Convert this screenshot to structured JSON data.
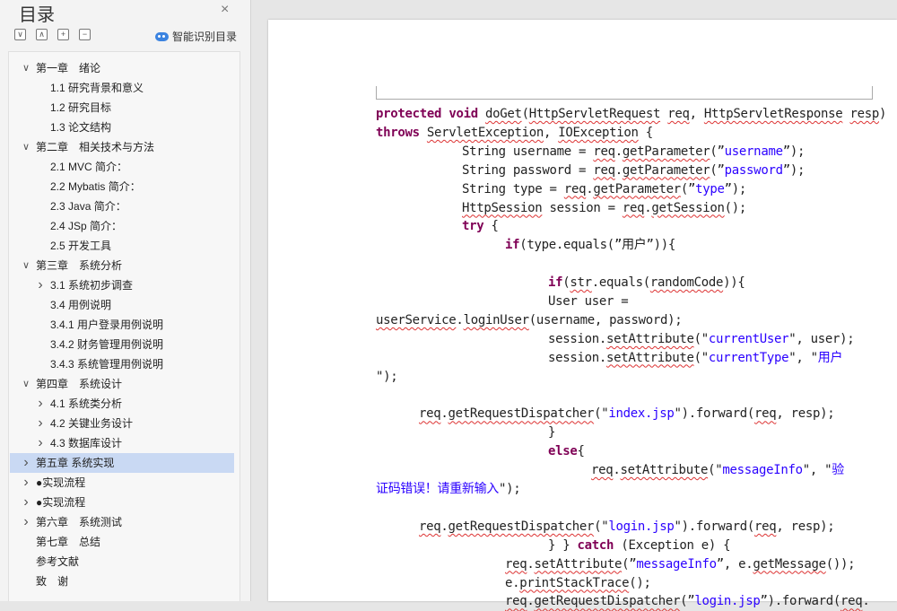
{
  "nav": {
    "title": "目录",
    "close_symbol": "×",
    "toolbar": {
      "collapse_all": "∨",
      "expand_all": "∧",
      "add": "+",
      "remove": "−"
    },
    "smart_label": "智能识别目录",
    "items": [
      {
        "label": "第一章　绪论",
        "level": 1,
        "arrow": "down"
      },
      {
        "label": "1.1 研究背景和意义",
        "level": 2
      },
      {
        "label": "1.2 研究目标",
        "level": 2
      },
      {
        "label": "1.3 论文结构",
        "level": 2
      },
      {
        "label": "第二章　相关技术与方法",
        "level": 1,
        "arrow": "down"
      },
      {
        "label": "2.1 MVC 简介：",
        "level": 2
      },
      {
        "label": "2.2 Mybatis 简介：",
        "level": 2
      },
      {
        "label": "2.3 Java 简介：",
        "level": 2
      },
      {
        "label": "2.4 JSp 简介：",
        "level": 2
      },
      {
        "label": "2.5 开发工具",
        "level": 2
      },
      {
        "label": "第三章　系统分析",
        "level": 1,
        "arrow": "down"
      },
      {
        "label": "3.1 系统初步调查",
        "level": 2,
        "arrow": "right"
      },
      {
        "label": "3.4 用例说明",
        "level": 2
      },
      {
        "label": "3.4.1 用户登录用例说明",
        "level": 2
      },
      {
        "label": "3.4.2 财务管理用例说明",
        "level": 2
      },
      {
        "label": "3.4.3 系统管理用例说明",
        "level": 2
      },
      {
        "label": "第四章　系统设计",
        "level": 1,
        "arrow": "down"
      },
      {
        "label": "4.1 系统类分析",
        "level": 2,
        "arrow": "right"
      },
      {
        "label": "4.2 关键业务设计",
        "level": 2,
        "arrow": "right"
      },
      {
        "label": "4.3 数据库设计",
        "level": 2,
        "arrow": "right"
      },
      {
        "label": "第五章  系统实现",
        "level": 1,
        "arrow": "right",
        "selected": true
      },
      {
        "label": "●实现流程",
        "level": 1,
        "arrow": "right"
      },
      {
        "label": "●实现流程",
        "level": 1,
        "arrow": "right"
      },
      {
        "label": "第六章　系统测试",
        "level": 1,
        "arrow": "right"
      },
      {
        "label": "第七章　总结",
        "level": 1
      },
      {
        "label": "参考文献",
        "level": 1
      },
      {
        "label": "致　谢",
        "level": 1
      }
    ]
  },
  "code_lines": [
    {
      "indent": 0,
      "tokens": [
        {
          "t": "protected",
          "c": "k"
        },
        {
          "t": " "
        },
        {
          "t": "void",
          "c": "k"
        },
        {
          "t": " "
        },
        {
          "t": "doGet",
          "c": "w"
        },
        {
          "t": "("
        },
        {
          "t": "HttpServletRequest",
          "c": "w"
        },
        {
          "t": " "
        },
        {
          "t": "req",
          "c": "w"
        },
        {
          "t": ", "
        },
        {
          "t": "HttpServletResponse",
          "c": "w"
        },
        {
          "t": " "
        },
        {
          "t": "resp",
          "c": "w"
        },
        {
          "t": ")"
        }
      ]
    },
    {
      "indent": 0,
      "tokens": [
        {
          "t": "throws",
          "c": "k"
        },
        {
          "t": " "
        },
        {
          "t": "ServletException",
          "c": "w"
        },
        {
          "t": ", "
        },
        {
          "t": "IOException",
          "c": "w"
        },
        {
          "t": " {"
        }
      ]
    },
    {
      "indent": 96,
      "tokens": [
        {
          "t": "String username = "
        },
        {
          "t": "req",
          "c": "w"
        },
        {
          "t": "."
        },
        {
          "t": "getParameter",
          "c": "w"
        },
        {
          "t": "(”"
        },
        {
          "t": "username",
          "c": "s"
        },
        {
          "t": "”);"
        }
      ]
    },
    {
      "indent": 96,
      "tokens": [
        {
          "t": "String password = "
        },
        {
          "t": "req",
          "c": "w"
        },
        {
          "t": "."
        },
        {
          "t": "getParameter",
          "c": "w"
        },
        {
          "t": "(”"
        },
        {
          "t": "password",
          "c": "s"
        },
        {
          "t": "”);"
        }
      ]
    },
    {
      "indent": 96,
      "tokens": [
        {
          "t": "String type = "
        },
        {
          "t": "req",
          "c": "w"
        },
        {
          "t": "."
        },
        {
          "t": "getParameter",
          "c": "w"
        },
        {
          "t": "(”"
        },
        {
          "t": "type",
          "c": "s"
        },
        {
          "t": "”);"
        }
      ]
    },
    {
      "indent": 96,
      "tokens": [
        {
          "t": "HttpSession",
          "c": "w"
        },
        {
          "t": " session = "
        },
        {
          "t": "req",
          "c": "w"
        },
        {
          "t": "."
        },
        {
          "t": "getSession",
          "c": "w"
        },
        {
          "t": "();"
        }
      ]
    },
    {
      "indent": 96,
      "tokens": [
        {
          "t": "try",
          "c": "k"
        },
        {
          "t": " {"
        }
      ]
    },
    {
      "indent": 144,
      "tokens": [
        {
          "t": "if",
          "c": "k"
        },
        {
          "t": "(type.equals(”用户”)){"
        }
      ]
    },
    {
      "indent": 0,
      "tokens": []
    },
    {
      "indent": 192,
      "tokens": [
        {
          "t": "if",
          "c": "k"
        },
        {
          "t": "("
        },
        {
          "t": "str",
          "c": "w"
        },
        {
          "t": ".equals("
        },
        {
          "t": "randomCode",
          "c": "w"
        },
        {
          "t": ")){"
        }
      ]
    },
    {
      "indent": 192,
      "tokens": [
        {
          "t": "User user ="
        }
      ]
    },
    {
      "indent": 0,
      "tokens": [
        {
          "t": "userService",
          "c": "w"
        },
        {
          "t": "."
        },
        {
          "t": "loginUser",
          "c": "w"
        },
        {
          "t": "(username, password);"
        }
      ]
    },
    {
      "indent": 192,
      "tokens": [
        {
          "t": "session."
        },
        {
          "t": "setAttribute",
          "c": "w"
        },
        {
          "t": "(\""
        },
        {
          "t": "currentUser",
          "c": "s"
        },
        {
          "t": "\", user);"
        }
      ]
    },
    {
      "indent": 192,
      "tokens": [
        {
          "t": "session."
        },
        {
          "t": "setAttribute",
          "c": "w"
        },
        {
          "t": "(\""
        },
        {
          "t": "currentType",
          "c": "s"
        },
        {
          "t": "\", \""
        },
        {
          "t": "用户",
          "c": "s"
        }
      ]
    },
    {
      "indent": 0,
      "tokens": [
        {
          "t": "\");"
        }
      ]
    },
    {
      "indent": 0,
      "tokens": []
    },
    {
      "indent": 48,
      "tokens": [
        {
          "t": "req",
          "c": "w"
        },
        {
          "t": "."
        },
        {
          "t": "getRequestDispatcher",
          "c": "w"
        },
        {
          "t": "(\""
        },
        {
          "t": "index.jsp",
          "c": "s"
        },
        {
          "t": "\").forward("
        },
        {
          "t": "req",
          "c": "w"
        },
        {
          "t": ", resp);"
        }
      ]
    },
    {
      "indent": 192,
      "tokens": [
        {
          "t": "}"
        }
      ]
    },
    {
      "indent": 192,
      "tokens": [
        {
          "t": "else",
          "c": "k"
        },
        {
          "t": "{"
        }
      ]
    },
    {
      "indent": 240,
      "tokens": [
        {
          "t": "req",
          "c": "w"
        },
        {
          "t": "."
        },
        {
          "t": "setAttribute",
          "c": "w"
        },
        {
          "t": "(\""
        },
        {
          "t": "messageInfo",
          "c": "s"
        },
        {
          "t": "\", \""
        },
        {
          "t": "验",
          "c": "s"
        }
      ]
    },
    {
      "indent": 0,
      "tokens": [
        {
          "t": "证码错误！请重新输入",
          "c": "s"
        },
        {
          "t": "\");"
        }
      ]
    },
    {
      "indent": 0,
      "tokens": []
    },
    {
      "indent": 48,
      "tokens": [
        {
          "t": "req",
          "c": "w"
        },
        {
          "t": "."
        },
        {
          "t": "getRequestDispatcher",
          "c": "w"
        },
        {
          "t": "(\""
        },
        {
          "t": "login.jsp",
          "c": "s"
        },
        {
          "t": "\").forward("
        },
        {
          "t": "req",
          "c": "w"
        },
        {
          "t": ", resp);"
        }
      ]
    },
    {
      "indent": 192,
      "tokens": [
        {
          "t": "}"
        },
        {
          "t": "          } "
        },
        {
          "t": "catch",
          "c": "k"
        },
        {
          "t": " (Exception e) {"
        }
      ]
    },
    {
      "indent": 144,
      "tokens": [
        {
          "t": "req",
          "c": "w"
        },
        {
          "t": "."
        },
        {
          "t": "setAttribute",
          "c": "w"
        },
        {
          "t": "(”"
        },
        {
          "t": "messageInfo",
          "c": "s"
        },
        {
          "t": "”, e."
        },
        {
          "t": "getMessage",
          "c": "w"
        },
        {
          "t": "());"
        }
      ]
    },
    {
      "indent": 144,
      "tokens": [
        {
          "t": "e."
        },
        {
          "t": "printStackTrace",
          "c": "w"
        },
        {
          "t": "();"
        }
      ]
    },
    {
      "indent": 144,
      "tokens": [
        {
          "t": "req",
          "c": "w"
        },
        {
          "t": "."
        },
        {
          "t": "getRequestDispatcher",
          "c": "w"
        },
        {
          "t": "(”"
        },
        {
          "t": "login.jsp",
          "c": "s"
        },
        {
          "t": "”).forward("
        },
        {
          "t": "req",
          "c": "w"
        },
        {
          "t": "."
        }
      ]
    }
  ]
}
